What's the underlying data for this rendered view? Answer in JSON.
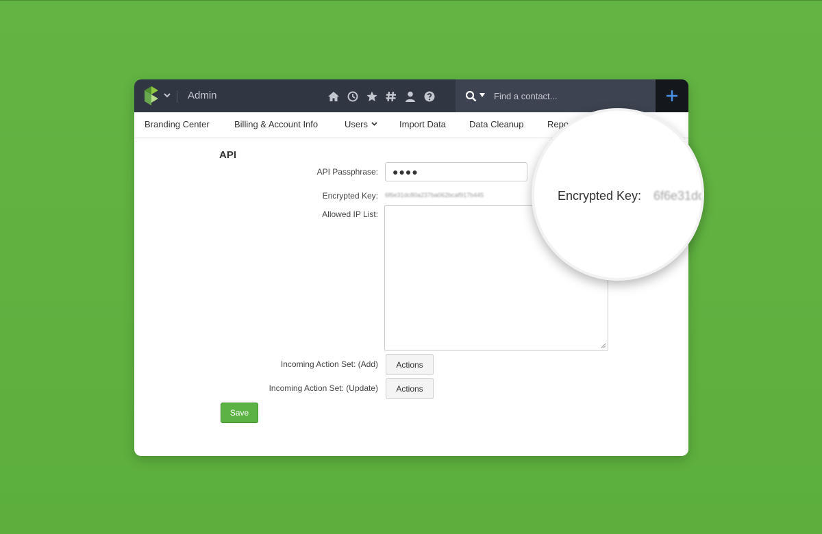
{
  "header": {
    "app_title": "Admin",
    "icons": [
      "home-icon",
      "history-icon",
      "star-icon",
      "hashtag-icon",
      "user-icon",
      "help-icon"
    ],
    "search": {
      "placeholder": "Find a contact..."
    },
    "add_label": "+"
  },
  "nav": {
    "items": [
      {
        "label": "Branding Center"
      },
      {
        "label": "Billing & Account Info"
      },
      {
        "label": "Users",
        "has_dropdown": true
      },
      {
        "label": "Import Data"
      },
      {
        "label": "Data Cleanup"
      },
      {
        "label": "Repo"
      }
    ]
  },
  "api": {
    "section_title": "API",
    "passphrase_label": "API Passphrase:",
    "passphrase_value": "●●●●",
    "encrypted_key_label": "Encrypted Key:",
    "encrypted_key_value": "6f6e31dc80a237ba062bcaf917b445",
    "allowed_ip_label": "Allowed IP List:",
    "allowed_ip_value": "",
    "incoming_add_label": "Incoming Action Set: (Add)",
    "incoming_update_label": "Incoming Action Set: (Update)",
    "actions_label": "Actions",
    "save_label": "Save"
  },
  "magnifier": {
    "label": "Encrypted Key:",
    "value": "6f6e31dc"
  },
  "colors": {
    "background": "#5cb33e",
    "topbar": "#303642",
    "search_box": "#3d4350",
    "add_button": "#14171c",
    "accent_blue": "#4a90e2",
    "save_green": "#5cb344"
  }
}
